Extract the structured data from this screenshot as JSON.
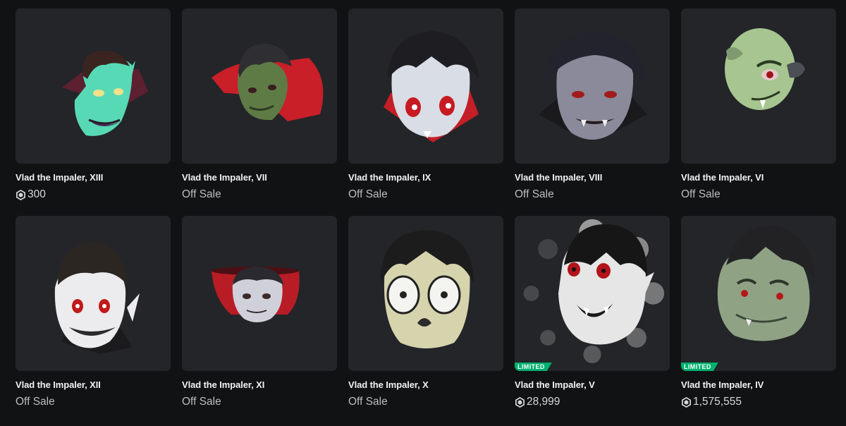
{
  "items": [
    {
      "name": "Vlad the Impaler, XIII",
      "price": "300",
      "on_sale": true,
      "limited": false,
      "icon": "vampire-head-teal-skin"
    },
    {
      "name": "Vlad the Impaler, VII",
      "price": "Off Sale",
      "on_sale": false,
      "limited": false,
      "icon": "vampire-head-green-skin-red-cape"
    },
    {
      "name": "Vlad the Impaler, IX",
      "price": "Off Sale",
      "on_sale": false,
      "limited": false,
      "icon": "vampire-head-pale-red-eyes"
    },
    {
      "name": "Vlad the Impaler, VIII",
      "price": "Off Sale",
      "on_sale": false,
      "limited": false,
      "icon": "vampire-head-gray-skin"
    },
    {
      "name": "Vlad the Impaler, VI",
      "price": "Off Sale",
      "on_sale": false,
      "limited": false,
      "icon": "vampire-head-green-bald"
    },
    {
      "name": "Vlad the Impaler, XII",
      "price": "Off Sale",
      "on_sale": false,
      "limited": false,
      "icon": "vampire-head-white-grin"
    },
    {
      "name": "Vlad the Impaler, XI",
      "price": "Off Sale",
      "on_sale": false,
      "limited": false,
      "icon": "vampire-head-small-red-collar"
    },
    {
      "name": "Vlad the Impaler, X",
      "price": "Off Sale",
      "on_sale": false,
      "limited": false,
      "icon": "vampire-head-cartoon-pale"
    },
    {
      "name": "Vlad the Impaler, V",
      "price": "28,999",
      "on_sale": true,
      "limited": true,
      "limited_label": "LIMITED",
      "loading": true,
      "icon": "vampire-head-classic-bw"
    },
    {
      "name": "Vlad the Impaler, IV",
      "price": "1,575,555",
      "on_sale": true,
      "limited": true,
      "limited_label": "LIMITED",
      "icon": "vampire-head-green-round"
    }
  ],
  "colors": {
    "background": "#111214",
    "card": "#232529",
    "limited_badge": "#00b06f"
  },
  "currency_icon": "robux-icon"
}
